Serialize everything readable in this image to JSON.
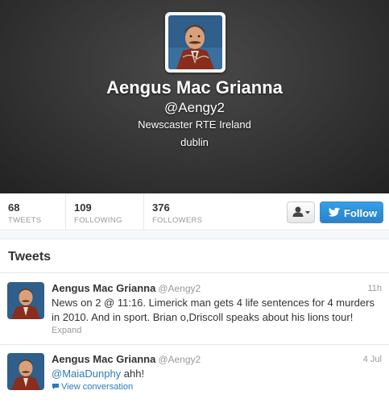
{
  "profile": {
    "name": "Aengus Mac Grianna",
    "handle": "@Aengy2",
    "bio": "Newscaster RTE Ireland",
    "location": "dublin",
    "avatar_icon": "profile-photo"
  },
  "stats": [
    {
      "value": "68",
      "label": "TWEETS"
    },
    {
      "value": "109",
      "label": "FOLLOWING"
    },
    {
      "value": "376",
      "label": "FOLLOWERS"
    }
  ],
  "actions": {
    "user_menu_icon": "person-dropdown-icon",
    "follow_label": "Follow",
    "follow_icon": "twitter-bird-icon"
  },
  "colors": {
    "accent": "#2b7bb9",
    "follow_button": "#2a82c9",
    "header_bg": "#333333"
  },
  "tweets_heading": "Tweets",
  "tweets": [
    {
      "name": "Aengus Mac Grianna",
      "handle": "@Aengy2",
      "time": "11h",
      "text_line1": "News on 2 @ 11:16. Limerick man gets 4 life sentences for 4 murders",
      "text_line2": "in 2010.  And in sport. Brian o,Driscoll speaks about his lions tour!",
      "action": "Expand"
    },
    {
      "name": "Aengus Mac Grianna",
      "handle": "@Aengy2",
      "time": "4 Jul",
      "mention": "@MaiaDunphy",
      "text_rest": " ahh!",
      "action": "View conversation"
    }
  ]
}
